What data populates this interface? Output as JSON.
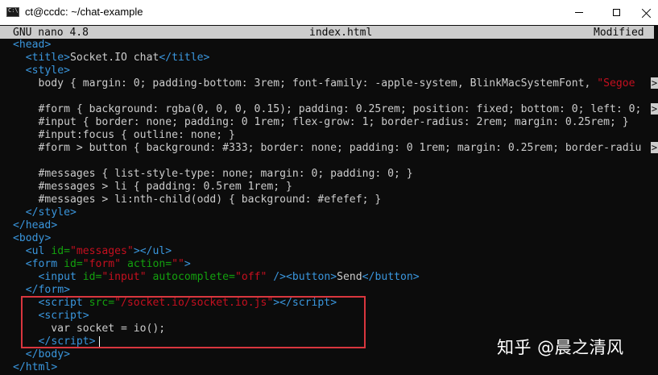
{
  "window": {
    "title": "ct@ccdc: ~/chat-example",
    "icon": "console-icon",
    "controls": [
      "minimize",
      "maximize",
      "close"
    ]
  },
  "nano": {
    "version": "GNU nano 4.8",
    "filename": "index.html",
    "status": "Modified"
  },
  "overflow_marker": ">",
  "code_lines": [
    [
      [
        "tag",
        "<"
      ],
      [
        "tagname",
        "head"
      ],
      [
        "tag",
        ">"
      ]
    ],
    [
      [
        "tag",
        "  <"
      ],
      [
        "tagname",
        "title"
      ],
      [
        "tag",
        ">"
      ],
      [
        "txt",
        "Socket.IO chat"
      ],
      [
        "tag",
        "</"
      ],
      [
        "tagname",
        "title"
      ],
      [
        "tag",
        ">"
      ]
    ],
    [
      [
        "tag",
        "  <"
      ],
      [
        "tagname",
        "style"
      ],
      [
        "tag",
        ">"
      ]
    ],
    [
      [
        "txt",
        "    body { margin: 0; padding-bottom: 3rem; font-family: -apple-system, BlinkMacSystemFont, "
      ],
      [
        "str",
        "\"Segoe"
      ]
    ],
    [
      [
        "txt",
        ""
      ]
    ],
    [
      [
        "txt",
        "    #form { background: rgba(0, 0, 0, 0.15); padding: 0.25rem; position: fixed; bottom: 0; left: 0;"
      ]
    ],
    [
      [
        "txt",
        "    #input { border: none; padding: 0 1rem; flex-grow: 1; border-radius: 2rem; margin: 0.25rem; }"
      ]
    ],
    [
      [
        "txt",
        "    #input:focus { outline: none; }"
      ]
    ],
    [
      [
        "txt",
        "    #form > button { background: #333; border: none; padding: 0 1rem; margin: 0.25rem; border-radiu"
      ]
    ],
    [
      [
        "txt",
        ""
      ]
    ],
    [
      [
        "txt",
        "    #messages { list-style-type: none; margin: 0; padding: 0; }"
      ]
    ],
    [
      [
        "txt",
        "    #messages > li { padding: 0.5rem 1rem; }"
      ]
    ],
    [
      [
        "txt",
        "    #messages > li:nth-child(odd) { background: #efefef; }"
      ]
    ],
    [
      [
        "tag",
        "  </"
      ],
      [
        "tagname",
        "style"
      ],
      [
        "tag",
        ">"
      ]
    ],
    [
      [
        "tag",
        "</"
      ],
      [
        "tagname",
        "head"
      ],
      [
        "tag",
        ">"
      ]
    ],
    [
      [
        "tag",
        "<"
      ],
      [
        "tagname",
        "body"
      ],
      [
        "tag",
        ">"
      ]
    ],
    [
      [
        "tag",
        "  <"
      ],
      [
        "tagname",
        "ul"
      ],
      [
        "attr",
        " id="
      ],
      [
        "str",
        "\"messages\""
      ],
      [
        "tag",
        "></"
      ],
      [
        "tagname",
        "ul"
      ],
      [
        "tag",
        ">"
      ]
    ],
    [
      [
        "tag",
        "  <"
      ],
      [
        "tagname",
        "form"
      ],
      [
        "attr",
        " id="
      ],
      [
        "str",
        "\"form\""
      ],
      [
        "attr",
        " action="
      ],
      [
        "str",
        "\"\""
      ],
      [
        "tag",
        ">"
      ]
    ],
    [
      [
        "tag",
        "    <"
      ],
      [
        "tagname",
        "input"
      ],
      [
        "attr",
        " id="
      ],
      [
        "str",
        "\"input\""
      ],
      [
        "attr",
        " autocomplete="
      ],
      [
        "str",
        "\"off\""
      ],
      [
        "tag",
        " /><"
      ],
      [
        "tagname",
        "button"
      ],
      [
        "tag",
        ">"
      ],
      [
        "txt",
        "Send"
      ],
      [
        "tag",
        "</"
      ],
      [
        "tagname",
        "button"
      ],
      [
        "tag",
        ">"
      ]
    ],
    [
      [
        "tag",
        "  </"
      ],
      [
        "tagname",
        "form"
      ],
      [
        "tag",
        ">"
      ]
    ],
    [
      [
        "tag",
        "    <"
      ],
      [
        "tagname",
        "script"
      ],
      [
        "attr",
        " src="
      ],
      [
        "str",
        "\"/socket.io/socket.io.js\""
      ],
      [
        "tag",
        "></"
      ],
      [
        "tagname",
        "script"
      ],
      [
        "tag",
        ">"
      ]
    ],
    [
      [
        "tag",
        "    <"
      ],
      [
        "tagname",
        "script"
      ],
      [
        "tag",
        ">"
      ]
    ],
    [
      [
        "txt",
        "      var socket = io();"
      ]
    ],
    [
      [
        "tag",
        "    </"
      ],
      [
        "tagname",
        "script"
      ],
      [
        "tag",
        ">"
      ]
    ],
    [
      [
        "tag",
        "  </"
      ],
      [
        "tagname",
        "body"
      ],
      [
        "tag",
        ">"
      ]
    ],
    [
      [
        "tag",
        "</"
      ],
      [
        "tagname",
        "html"
      ],
      [
        "tag",
        ">"
      ]
    ]
  ],
  "watermark": "知乎 @晨之清风",
  "colors": {
    "background": "#0c0c0c",
    "header_bar": "#cccccc",
    "tag": "#3a96dd",
    "attribute": "#13a10e",
    "string": "#c50f1f",
    "text": "#cccccc",
    "highlight_box": "#d9363e"
  }
}
